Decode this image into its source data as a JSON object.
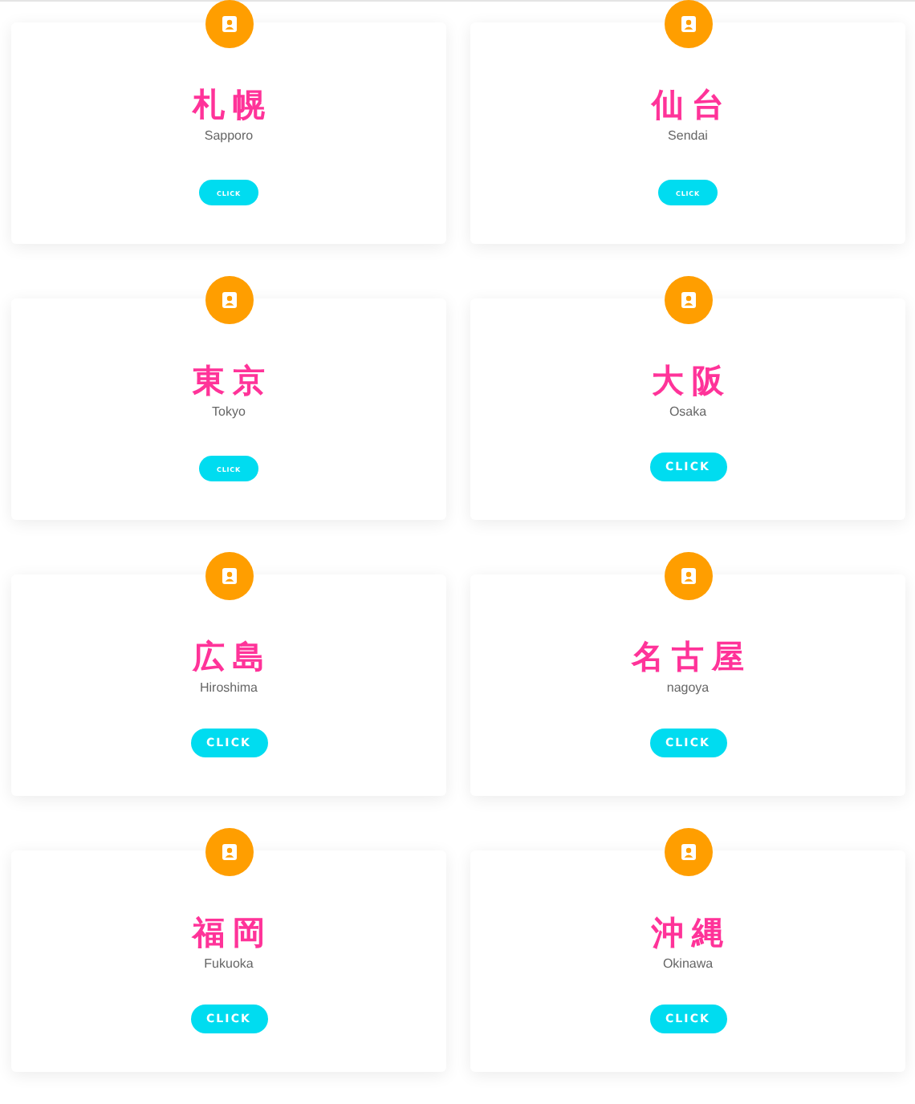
{
  "cards": [
    {
      "title": "札幌",
      "subtitle": "Sapporo",
      "button": "CLICK",
      "compact": true
    },
    {
      "title": "仙台",
      "subtitle": "Sendai",
      "button": "CLICK",
      "compact": true
    },
    {
      "title": "東京",
      "subtitle": "Tokyo",
      "button": "CLICK",
      "compact": true
    },
    {
      "title": "大阪",
      "subtitle": "Osaka",
      "button": "CLICK",
      "compact": false
    },
    {
      "title": "広島",
      "subtitle": "Hiroshima",
      "button": "CLICK",
      "compact": false
    },
    {
      "title": "名古屋",
      "subtitle": "nagoya",
      "button": "CLICK",
      "compact": false
    },
    {
      "title": "福岡",
      "subtitle": "Fukuoka",
      "button": "CLICK",
      "compact": false
    },
    {
      "title": "沖縄",
      "subtitle": "Okinawa",
      "button": "CLICK",
      "compact": false
    }
  ]
}
